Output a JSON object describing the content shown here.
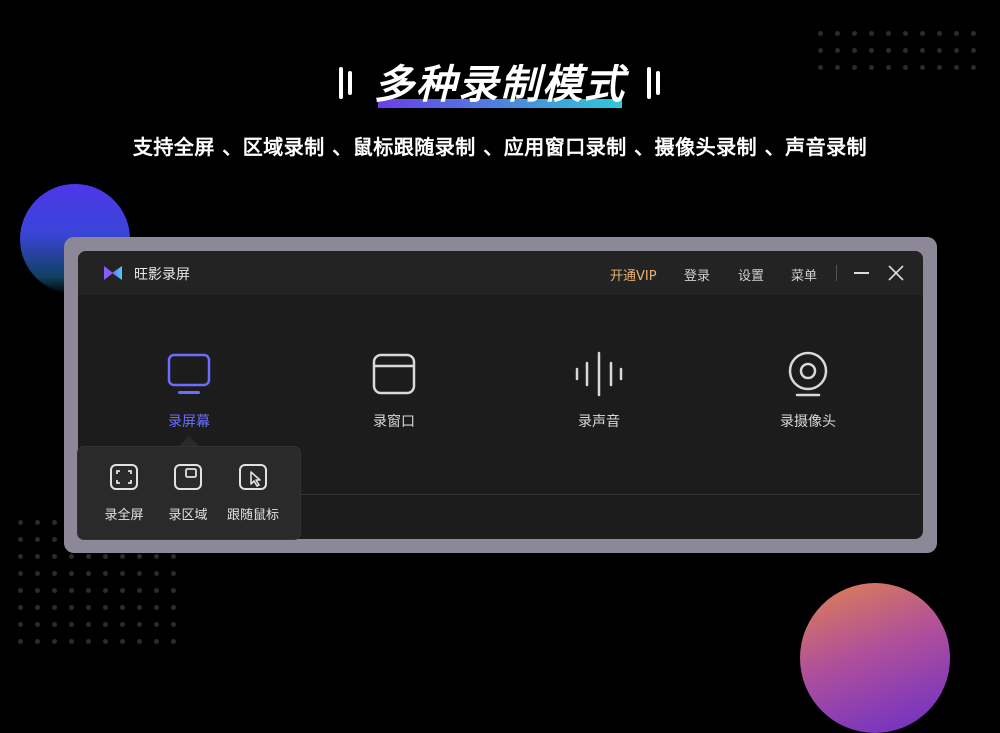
{
  "headline": {
    "title": "多种录制模式",
    "subtitle": "支持全屏 、区域录制 、鼠标跟随录制 、应用窗口录制 、摄像头录制 、声音录制"
  },
  "app": {
    "name": "旺影录屏",
    "titlebar": {
      "vip": "开通VIP",
      "login": "登录",
      "settings": "设置",
      "menu": "菜单"
    },
    "modes": [
      {
        "label": "录屏幕",
        "icon": "monitor-icon",
        "active": true
      },
      {
        "label": "录窗口",
        "icon": "window-icon",
        "active": false
      },
      {
        "label": "录声音",
        "icon": "audio-wave-icon",
        "active": false
      },
      {
        "label": "录摄像头",
        "icon": "webcam-icon",
        "active": false
      }
    ],
    "screen_submenu": [
      {
        "label": "录全屏",
        "icon": "fullscreen-icon"
      },
      {
        "label": "录区域",
        "icon": "region-icon"
      },
      {
        "label": "跟随鼠标",
        "icon": "follow-cursor-icon"
      }
    ]
  },
  "colors": {
    "accent": "#6c6cff",
    "vip": "#e7b273",
    "window_bg": "#1c1c1c",
    "frame": "#8d8897"
  }
}
